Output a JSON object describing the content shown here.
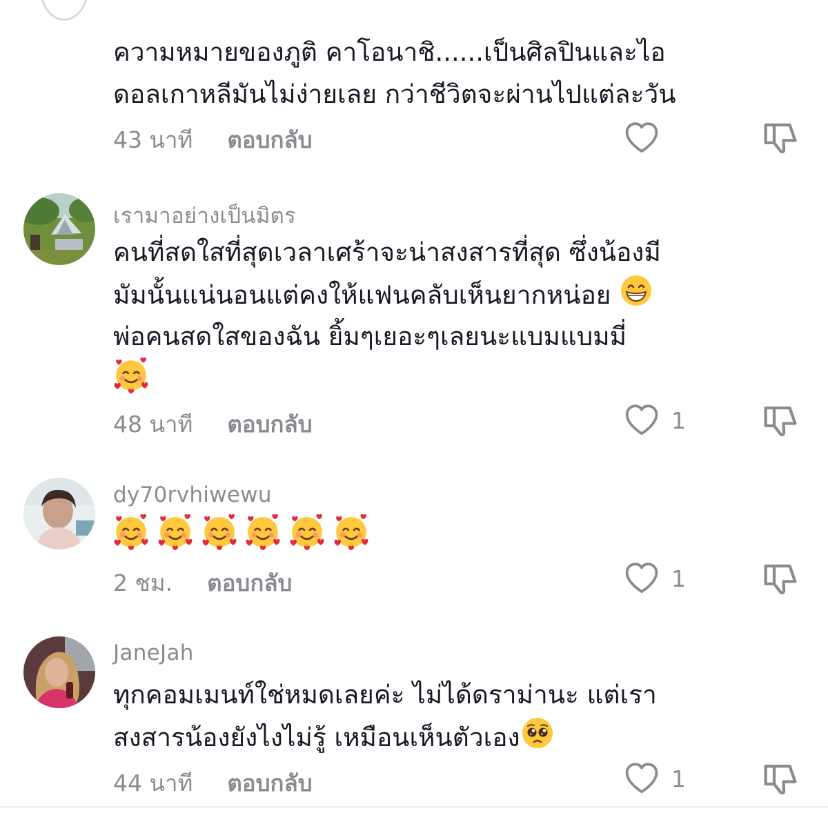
{
  "comments": [
    {
      "username": "",
      "lines": [
        "ความหมายของภูติ คาโอนาชิ......เป็นศิลปินและไอ",
        "ดอลเกาหลีมันไม่ง่ายเลย กว่าชีวิตจะผ่านไปแต่ละวัน"
      ],
      "time": "43 นาที",
      "reply_label": "ตอบกลับ",
      "likes": ""
    },
    {
      "username": "เรามาอย่างเป็นมิตร",
      "lines": [
        "คนที่สดใสที่สุดเวลาเศร้าจะน่าสงสารที่สุด ซึ่งน้องมี",
        "มัมนั้นแน่นอนแต่คงให้แฟนคลับเห็นยากหน่อย",
        "พ่อคนสดใสของฉัน ยิ้มๆเยอะๆเลยนะแบมแบมมี่"
      ],
      "time": "48 นาที",
      "reply_label": "ตอบกลับ",
      "likes": "1"
    },
    {
      "username": "dy70rvhiwewu",
      "lines": [],
      "time": "2 ชม.",
      "reply_label": "ตอบกลับ",
      "likes": "1"
    },
    {
      "username": "JaneJah",
      "lines": [
        "ทุกคอมเมนท์ใช่หมดเลยค่ะ ไม่ได้ดราม่านะ แต่เรา",
        "สงสารน้องยังไงไม่รู้ เหมือนเห็นตัวเอง"
      ],
      "time": "44 นาที",
      "reply_label": "ตอบกลับ",
      "likes": "1"
    }
  ],
  "icons": {
    "like": "heart-outline-icon",
    "dislike": "thumbs-down-icon",
    "emoji_grin": "grinning-face-emoji",
    "emoji_hearts": "smiling-face-with-hearts-emoji",
    "emoji_pleading": "pleading-face-emoji"
  },
  "colors": {
    "text": "#161823",
    "secondary": "#8a8b91",
    "background": "#ffffff"
  }
}
